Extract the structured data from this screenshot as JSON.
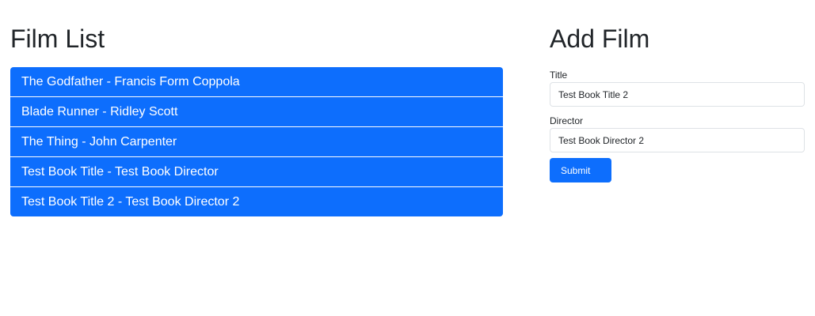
{
  "film_list": {
    "heading": "Film List",
    "items": [
      "The Godfather - Francis Form Coppola",
      "Blade Runner - Ridley Scott",
      "The Thing - John Carpenter",
      "Test Book Title - Test Book Director",
      "Test Book Title 2 - Test Book Director 2"
    ]
  },
  "add_film": {
    "heading": "Add Film",
    "title_label": "Title",
    "title_value": "Test Book Title 2",
    "director_label": "Director",
    "director_value": "Test Book Director 2",
    "submit_label": "Submit"
  },
  "colors": {
    "accent": "#0d6efd",
    "text": "#212529",
    "background": "#ffffff"
  }
}
